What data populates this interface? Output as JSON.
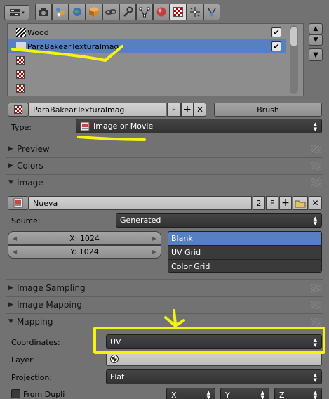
{
  "header": {
    "editor_type_icon": "properties-editor-icon",
    "tabs": [
      {
        "name": "render-tab",
        "icon": "camera-icon"
      },
      {
        "name": "scene-tab",
        "icon": "scene-icon"
      },
      {
        "name": "world-tab",
        "icon": "world-icon"
      },
      {
        "name": "object-tab",
        "icon": "cube-icon"
      },
      {
        "name": "constraints-tab",
        "icon": "chain-icon"
      },
      {
        "name": "modifiers-tab",
        "icon": "wrench-icon"
      },
      {
        "name": "data-tab",
        "icon": "vertex-icon"
      },
      {
        "name": "material-tab",
        "icon": "material-sphere-icon"
      },
      {
        "name": "texture-tab",
        "icon": "checker-texture-icon"
      },
      {
        "name": "particles-tab",
        "icon": "particles-icon"
      },
      {
        "name": "physics-tab",
        "icon": "physics-icon"
      }
    ]
  },
  "texture_slots": {
    "items": [
      {
        "label": "Wood",
        "icon": "wood-texture-icon",
        "checked": true,
        "selected": false
      },
      {
        "label": "ParaBakearTexturalmag",
        "icon": "image-texture-icon",
        "checked": true,
        "selected": true
      },
      {
        "label": "",
        "icon": "empty-slot-icon"
      },
      {
        "label": "",
        "icon": "empty-slot-icon"
      },
      {
        "label": "",
        "icon": "empty-slot-icon"
      }
    ],
    "side_buttons": [
      "up-arrow-icon",
      "down-arrow-icon",
      "dropdown-icon"
    ]
  },
  "texture_datablock": {
    "name": "ParaBakearTexturalmag",
    "fake_user": "F",
    "brush_label": "Brush"
  },
  "type_row": {
    "label": "Type:",
    "value": "Image or Movie"
  },
  "panels": {
    "preview": "Preview",
    "colors": "Colors",
    "image": "Image",
    "image_sampling": "Image Sampling",
    "image_mapping": "Image Mapping",
    "mapping": "Mapping"
  },
  "image_panel": {
    "image_name": "Nueva",
    "users": "2",
    "fake_user": "F",
    "source_label": "Source:",
    "source_value": "Generated",
    "x_field": "X: 1024",
    "y_field": "Y: 1024",
    "generated_types": [
      {
        "label": "Blank",
        "selected": true
      },
      {
        "label": "UV Grid",
        "selected": false
      },
      {
        "label": "Color Grid",
        "selected": false
      }
    ]
  },
  "mapping_panel": {
    "coordinates_label": "Coordinates:",
    "coordinates_value": "UV",
    "layer_label": "Layer:",
    "projection_label": "Projection:",
    "projection_value": "Flat",
    "from_dupli_label": "From Dupli",
    "x_label": "X",
    "y_label": "Y",
    "z_label": "Z"
  },
  "colors": {
    "background": "#727272",
    "selection_blue": "#5680c2",
    "annotation_yellow": "#f4f40c"
  }
}
